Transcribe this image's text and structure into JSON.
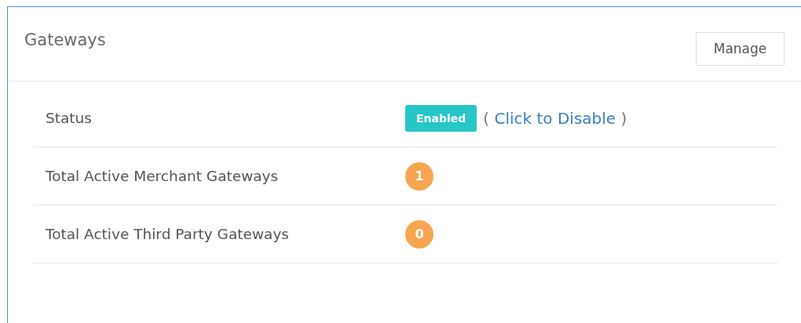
{
  "panel": {
    "title": "Gateways",
    "manage_button": "Manage"
  },
  "rows": [
    {
      "kind": "status",
      "label": "Status",
      "badge": "Enabled",
      "action_open": "(",
      "action_link": "Click to Disable",
      "action_close": ")"
    },
    {
      "kind": "count",
      "label": "Total Active Merchant Gateways",
      "count": "1"
    },
    {
      "kind": "count",
      "label": "Total Active Third Party Gateways",
      "count": "0"
    }
  ]
}
